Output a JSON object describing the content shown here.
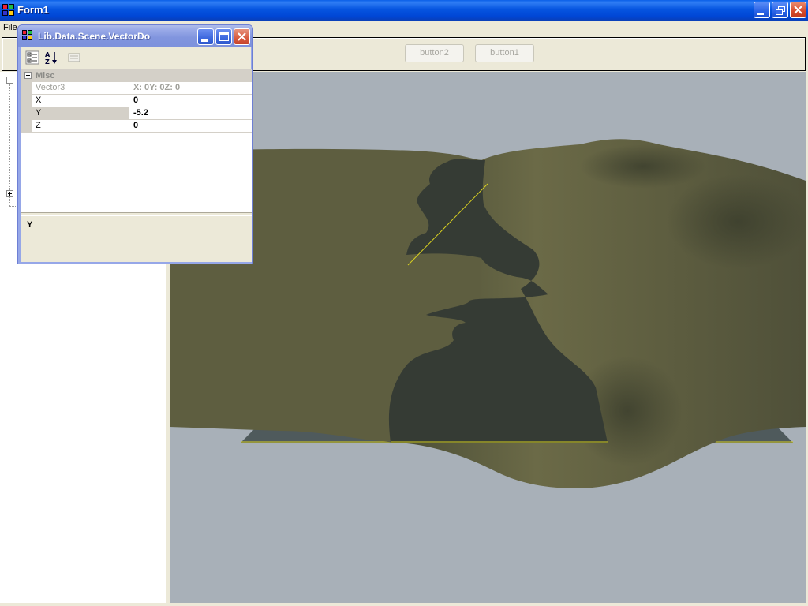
{
  "window": {
    "title": "Form1",
    "title_bar_color": "#0054e3"
  },
  "menu": {
    "file": "File"
  },
  "toolbar": {
    "button2_label": "button2",
    "button1_label": "button1"
  },
  "tree": {
    "nodes": [
      {
        "expander": "minus"
      },
      {
        "expander": "plus"
      }
    ]
  },
  "viewport": {
    "background_color": "#a8b0b8",
    "terrain_color": "#5e5e40",
    "shadow_color": "#353b34",
    "outline_color": "#d8d020"
  },
  "property_window": {
    "title": "Lib.Data.Scene.VectorDo",
    "toolbar_icons": [
      "categorized-icon",
      "alphabetical-icon",
      "property-pages-icon"
    ],
    "category": "Misc",
    "rows": [
      {
        "name": "Vector3",
        "value": "X: 0Y: 0Z: 0",
        "readonly": true
      },
      {
        "name": "X",
        "value": "0"
      },
      {
        "name": "Y",
        "value": "-5.2",
        "selected": true
      },
      {
        "name": "Z",
        "value": "0"
      }
    ],
    "description_title": "Y"
  }
}
